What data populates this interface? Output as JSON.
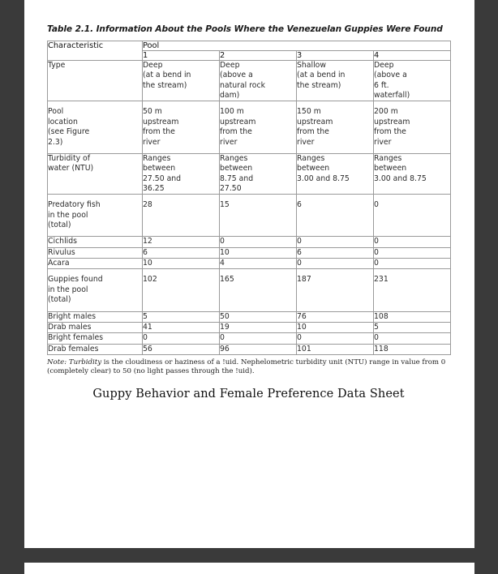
{
  "document": {
    "table_title": "Table 2.1. Information About the Pools Where the Venezuelan Guppies Were Found",
    "note_label": "Note:",
    "note_term": "Turbidity",
    "note_body": " is the cloudiness or haziness of a !uid. Nephelometric turbidity unit (NTU) range in value from 0 (completely clear) to 50 (no light passes through the !uid).",
    "sheet_caption": "Guppy Behavior and Female Preference Data Sheet"
  },
  "table": {
    "characteristic_header": "Characteristic",
    "group_header": "Pool",
    "pool_columns": [
      "1",
      "2",
      "3",
      "4"
    ],
    "rows": [
      {
        "label": "Type",
        "align": "left",
        "values": [
          "Deep\n(at a bend in\nthe stream)",
          "Deep\n(above a\nnatural rock\ndam)",
          "Shallow\n(at a bend in\nthe stream)",
          "Deep\n(above a\n6 ft.\nwaterfall)"
        ]
      },
      {
        "label": "Pool\nlocation\n(see Figure\n2.3)",
        "align": "left",
        "values": [
          "50 m\nupstream\nfrom the\nriver",
          "100 m\nupstream\nfrom the\nriver",
          "150 m\nupstream\nfrom the\nriver",
          "200 m\nupstream\nfrom the\nriver"
        ]
      },
      {
        "label": "Turbidity of\nwater (NTU)",
        "align": "left",
        "values": [
          "Ranges\nbetween\n27.50 and\n36.25",
          "Ranges\nbetween\n8.75 and\n27.50",
          "Ranges\nbetween\n3.00 and 8.75",
          "Ranges\nbetween\n3.00 and 8.75"
        ]
      },
      {
        "label": "Predatory fish\nin the pool\n(total)",
        "align": "center",
        "values": [
          "28",
          "15",
          "6",
          "0"
        ]
      },
      {
        "label": "Cichlids",
        "align": "center",
        "values": [
          "12",
          "0",
          "0",
          "0"
        ]
      },
      {
        "label": "Rivulus",
        "align": "center",
        "values": [
          "6",
          "10",
          "6",
          "0"
        ]
      },
      {
        "label": "Acara",
        "align": "center",
        "values": [
          "10",
          "4",
          "0",
          "0"
        ]
      },
      {
        "label": "Guppies found\nin the pool\n(total)",
        "align": "center",
        "values": [
          "102",
          "165",
          "187",
          "231"
        ]
      },
      {
        "label": "Bright males",
        "align": "center",
        "values": [
          "5",
          "50",
          "76",
          "108"
        ]
      },
      {
        "label": "Drab males",
        "align": "center",
        "values": [
          "41",
          "19",
          "10",
          "5"
        ]
      },
      {
        "label": "Bright females",
        "align": "center",
        "values": [
          "0",
          "0",
          "0",
          "0"
        ]
      },
      {
        "label": "Drab females",
        "align": "center",
        "values": [
          "56",
          "96",
          "101",
          "118"
        ]
      }
    ]
  },
  "colors": {
    "viewer_background": "#3a3a3a",
    "page_background": "#ffffff",
    "grid_line": "#9a9a9a",
    "body_text": "#2b2b2b"
  }
}
